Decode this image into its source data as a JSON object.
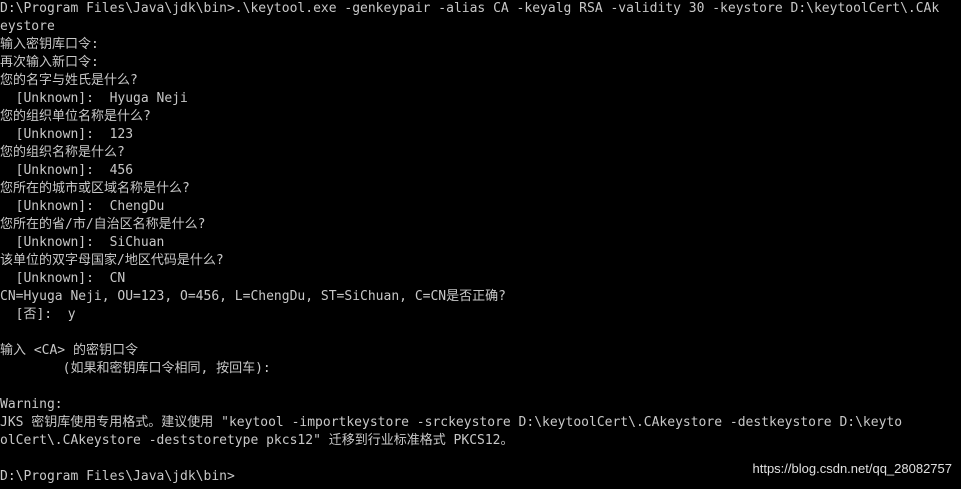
{
  "console": {
    "lines": [
      "D:\\Program Files\\Java\\jdk\\bin>.\\keytool.exe -genkeypair -alias CA -keyalg RSA -validity 30 -keystore D:\\keytoolCert\\.CAk",
      "eystore",
      "输入密钥库口令:",
      "再次输入新口令:",
      "您的名字与姓氏是什么?",
      "  [Unknown]:  Hyuga Neji",
      "您的组织单位名称是什么?",
      "  [Unknown]:  123",
      "您的组织名称是什么?",
      "  [Unknown]:  456",
      "您所在的城市或区域名称是什么?",
      "  [Unknown]:  ChengDu",
      "您所在的省/市/自治区名称是什么?",
      "  [Unknown]:  SiChuan",
      "该单位的双字母国家/地区代码是什么?",
      "  [Unknown]:  CN",
      "CN=Hyuga Neji, OU=123, O=456, L=ChengDu, ST=SiChuan, C=CN是否正确?",
      "  [否]:  y",
      "",
      "输入 <CA> 的密钥口令",
      "        (如果和密钥库口令相同, 按回车):",
      "",
      "Warning:",
      "JKS 密钥库使用专用格式。建议使用 \"keytool -importkeystore -srckeystore D:\\keytoolCert\\.CAkeystore -destkeystore D:\\keyto",
      "olCert\\.CAkeystore -deststoretype pkcs12\" 迁移到行业标准格式 PKCS12。",
      "",
      "D:\\Program Files\\Java\\jdk\\bin>"
    ]
  },
  "watermark": "https://blog.csdn.net/qq_28082757",
  "colors": {
    "background": "#000000",
    "text": "#c8c8c8",
    "watermark": "#e0e0e0"
  }
}
